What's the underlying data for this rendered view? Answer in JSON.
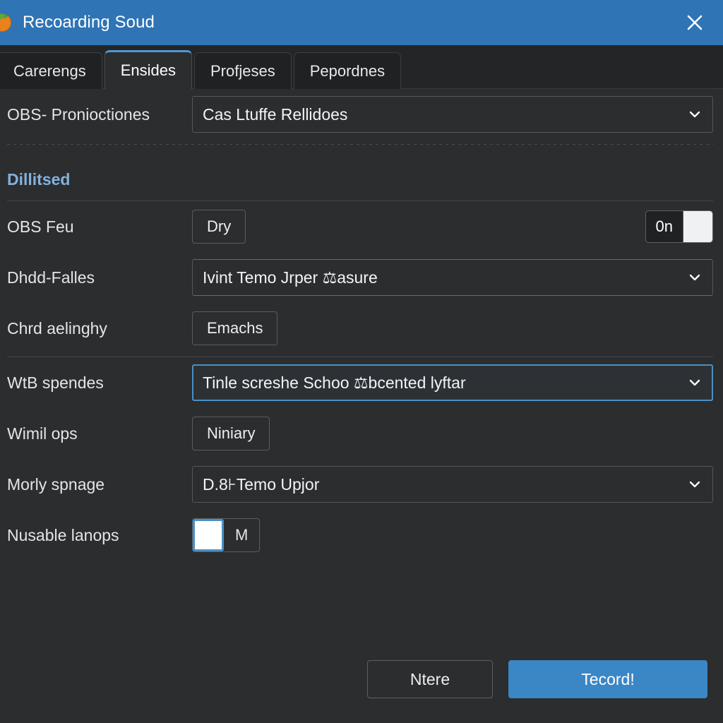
{
  "window": {
    "title": "Recoarding Soud",
    "app_icon": "app-logo-icon",
    "close_icon": "close-icon",
    "titlebar_color": "#2f74b5"
  },
  "tabs": [
    {
      "label": "Carerengs",
      "active": false
    },
    {
      "label": "Ensides",
      "active": true
    },
    {
      "label": "Profjeses",
      "active": false
    },
    {
      "label": "Pepordnes",
      "active": false
    }
  ],
  "top_section": {
    "row": {
      "label": "OBS- Pronioctiones",
      "value": "Cas Ltuffe Rellidoes",
      "chevron_icon": "chevron-down-icon"
    }
  },
  "section": {
    "header": "Dillitsed",
    "header_color": "#83b1dd"
  },
  "rows": [
    {
      "label": "OBS Feu",
      "control": "button",
      "button_label": "Dry",
      "toggle_label": "0n",
      "toggle_state": "on"
    },
    {
      "label": "Dhdd-Falles",
      "control": "combo",
      "value": "Ivint Temo Jrper ⚖asure",
      "chevron_icon": "chevron-down-icon"
    },
    {
      "label": "Chrd aelinghy",
      "control": "button",
      "button_label": "Emachs"
    },
    {
      "label": "WtB spendes",
      "control": "combo-focused",
      "value": "Tinle screshe Schoo ⚖bcented lyftar",
      "chevron_icon": "chevron-down-icon"
    },
    {
      "label": "Wimil ops",
      "control": "button",
      "button_label": "Niniary"
    },
    {
      "label": "Morly spnage",
      "control": "combo",
      "value": "D.8⊦Temo Upjor",
      "chevron_icon": "chevron-down-icon"
    },
    {
      "label": "Nusable lanops",
      "control": "checkbox",
      "checkbox_label": "M",
      "checked": true
    }
  ],
  "footer": {
    "cancel_label": "Ntere",
    "confirm_label": "Tecord!",
    "confirm_color": "#3b86c4"
  }
}
